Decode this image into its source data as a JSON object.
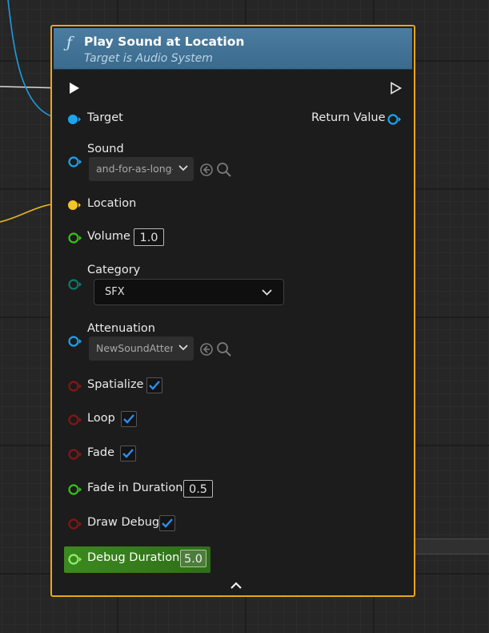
{
  "node": {
    "title": "Play Sound at Location",
    "subtitle": "Target is Audio System",
    "function_icon": "function-icon"
  },
  "pins": {
    "target": {
      "label": "Target"
    },
    "return_value": {
      "label": "Return Value"
    },
    "sound": {
      "label": "Sound",
      "value": "and-for-as-long-"
    },
    "location": {
      "label": "Location"
    },
    "volume": {
      "label": "Volume",
      "value": "1.0"
    },
    "category": {
      "label": "Category",
      "value": "SFX"
    },
    "attenuation": {
      "label": "Attenuation",
      "value": "NewSoundAttenu"
    },
    "spatialize": {
      "label": "Spatialize",
      "checked": true
    },
    "loop": {
      "label": "Loop",
      "checked": true
    },
    "fade": {
      "label": "Fade",
      "checked": true
    },
    "fade_in_duration": {
      "label": "Fade in Duration",
      "value": "0.5"
    },
    "draw_debug": {
      "label": "Draw Debug",
      "checked": true
    },
    "debug_duration": {
      "label": "Debug Duration",
      "value": "5.0"
    }
  },
  "colors": {
    "node_border": "#f0a31c",
    "header": "#3f7090",
    "object_pin": "#1aa4f0",
    "struct_pin": "#f3c428",
    "float_pin": "#38c21b",
    "byte_pin": "#0d7a6c",
    "bool_pin": "#8b1414",
    "checkmark": "#2a8ff0"
  }
}
